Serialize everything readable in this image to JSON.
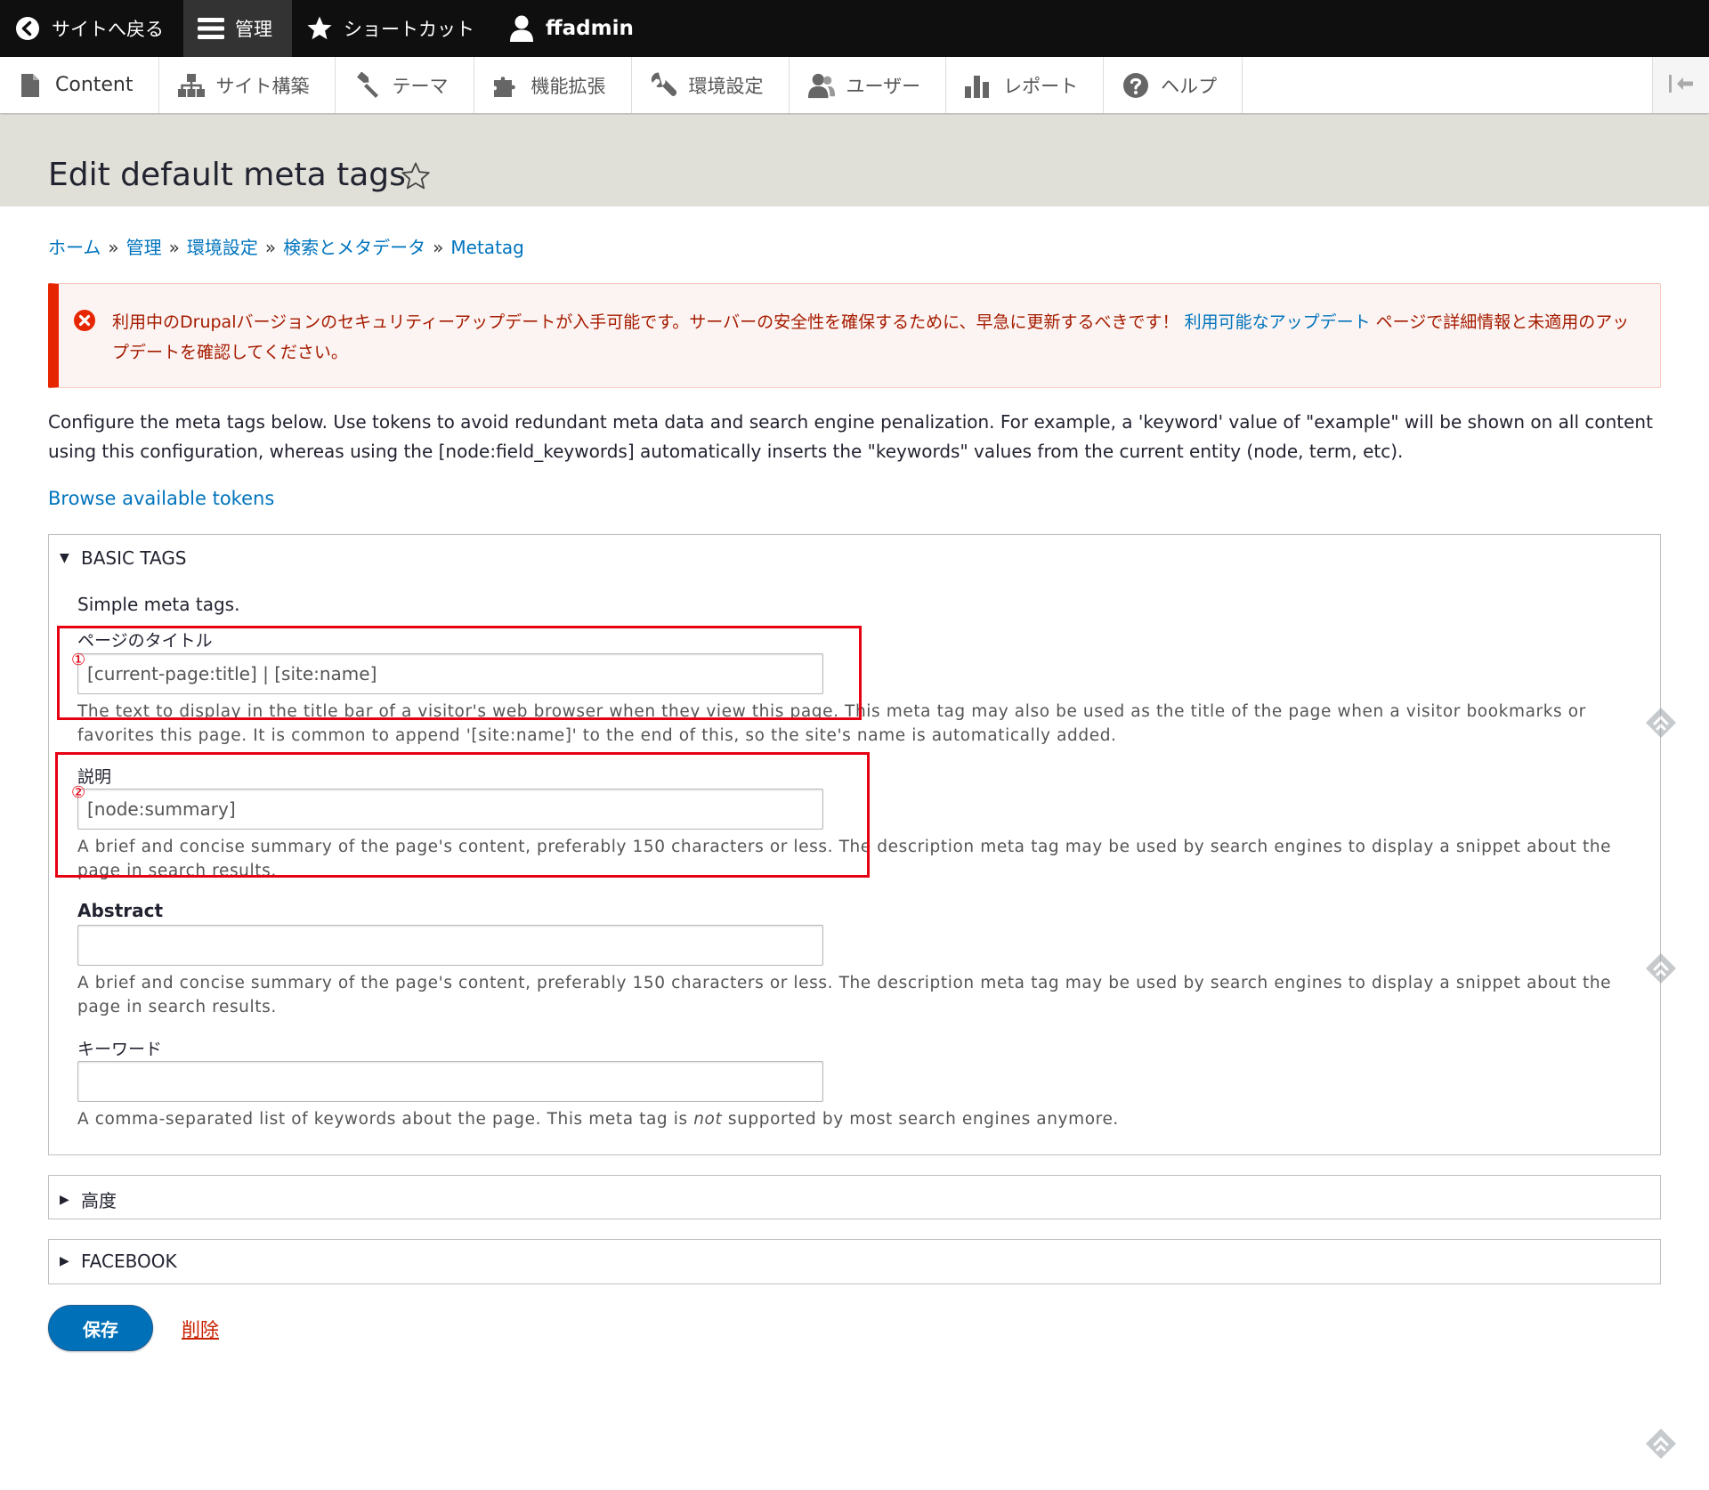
{
  "toolbar": {
    "back": "サイトへ戻る",
    "manage": "管理",
    "shortcuts": "ショートカット",
    "user": "ffadmin"
  },
  "tray": {
    "items": [
      {
        "label": "Content",
        "icon": "page-icon"
      },
      {
        "label": "サイト構築",
        "icon": "sitemap-icon"
      },
      {
        "label": "テーマ",
        "icon": "paintbrush-icon"
      },
      {
        "label": "機能拡張",
        "icon": "puzzle-icon"
      },
      {
        "label": "環境設定",
        "icon": "wrench-icon"
      },
      {
        "label": "ユーザー",
        "icon": "people-icon"
      },
      {
        "label": "レポート",
        "icon": "bar-chart-icon"
      },
      {
        "label": "ヘルプ",
        "icon": "help-icon"
      }
    ]
  },
  "page": {
    "title": "Edit default meta tags"
  },
  "breadcrumb": {
    "items": [
      "ホーム",
      "管理",
      "環境設定",
      "検索とメタデータ",
      "Metatag"
    ],
    "separator": "»"
  },
  "error": {
    "text_before": "利用中のDrupalバージョンのセキュリティーアップデートが入手可能です。サーバーの安全性を確保するために、早急に更新するべきです！ ",
    "link": "利用可能なアップデート",
    "text_after": " ページで詳細情報と未適用のアップデートを確認してください。"
  },
  "intro": {
    "text": "Configure the meta tags below. Use tokens to avoid redundant meta data and search engine penalization. For example, a 'keyword' value of \"example\" will be shown on all content using this configuration, whereas using the [node:field_keywords] automatically inserts the \"keywords\" values from the current entity (node, term, etc).",
    "tokens_link": "Browse available tokens"
  },
  "basic": {
    "summary": "BASIC TAGS",
    "description": "Simple meta tags.",
    "title_label": "ページのタイトル",
    "title_value": "[current-page:title] | [site:name]",
    "title_desc": "The text to display in the title bar of a visitor's web browser when they view this page. This meta tag may also be used as the title of the page when a visitor bookmarks or favorites this page. It is common to append '[site:name]' to the end of this, so the site's name is automatically added.",
    "desc_label": "説明",
    "desc_value": "[node:summary]",
    "desc_desc": "A brief and concise summary of the page's content, preferably 150 characters or less. The description meta tag may be used by search engines to display a snippet about the page in search results.",
    "abstract_label": "Abstract",
    "abstract_value": "",
    "abstract_desc": "A brief and concise summary of the page's content, preferably 150 characters or less. The description meta tag may be used by search engines to display a snippet about the page in search results.",
    "keywords_label": "キーワード",
    "keywords_value": "",
    "keywords_desc_before": "A comma-separated list of keywords about the page. This meta tag is ",
    "keywords_desc_em": "not",
    "keywords_desc_after": " supported by most search engines anymore."
  },
  "annotations": {
    "mark1": "①",
    "mark2": "②",
    "color": "#e60012"
  },
  "advanced": {
    "summary": "高度"
  },
  "facebook": {
    "summary": "FACEBOOK"
  },
  "actions": {
    "save": "保存",
    "delete": "削除"
  },
  "colors": {
    "link": "#0074bd",
    "primary_button": "#0071b8",
    "error_border": "#e62600",
    "toolbar_bg": "#0f0f0f"
  }
}
